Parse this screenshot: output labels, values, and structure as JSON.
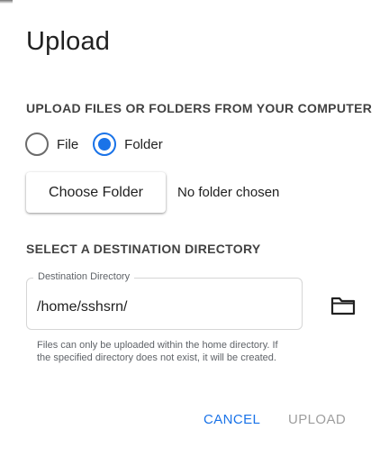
{
  "dialog": {
    "title": "Upload",
    "upload_section": {
      "heading": "UPLOAD FILES OR FOLDERS FROM YOUR COMPUTER",
      "options": [
        {
          "label": "File",
          "checked": false
        },
        {
          "label": "Folder",
          "checked": true
        }
      ],
      "choose_button_label": "Choose Folder",
      "chosen_status": "No folder chosen"
    },
    "destination_section": {
      "heading": "SELECT A DESTINATION DIRECTORY",
      "field_label": "Destination Directory",
      "field_value": "/home/sshsrn/",
      "browse_icon": "folder-icon",
      "helper_text": "Files can only be uploaded within the home directory. If the specified directory does not exist, it will be created."
    },
    "actions": {
      "cancel_label": "CANCEL",
      "upload_label": "UPLOAD",
      "upload_enabled": false
    },
    "colors": {
      "accent": "#1a73e8",
      "disabled": "#9e9e9e"
    }
  }
}
